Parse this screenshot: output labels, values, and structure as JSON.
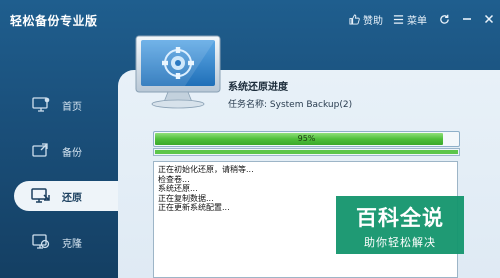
{
  "app": {
    "title": "轻松备份专业版"
  },
  "titlebar": {
    "praise_label": "赞助",
    "menu_label": "菜单"
  },
  "sidebar": {
    "items": [
      {
        "label": "首页",
        "icon": "home-monitor-icon"
      },
      {
        "label": "备份",
        "icon": "backup-icon"
      },
      {
        "label": "还原",
        "icon": "restore-icon",
        "active": true
      },
      {
        "label": "克隆",
        "icon": "clone-icon"
      }
    ]
  },
  "task": {
    "title": "系统还原进度",
    "name_label": "任务名称:",
    "name_value": "System Backup(2)"
  },
  "progress": {
    "percent_text": "95%",
    "value": 0.95,
    "secondary_value": 1.0
  },
  "log": {
    "lines": [
      "正在初始化还原，请稍等...",
      "检查卷...",
      "系统还原...",
      "正在复制数据...",
      "正在更新系统配置..."
    ]
  },
  "watermark": {
    "title": "百科全说",
    "subtitle": "助你轻松解决"
  },
  "colors": {
    "accent": "#1a4f7a",
    "progress": "#4fbf3a",
    "watermark": "#16966e"
  }
}
